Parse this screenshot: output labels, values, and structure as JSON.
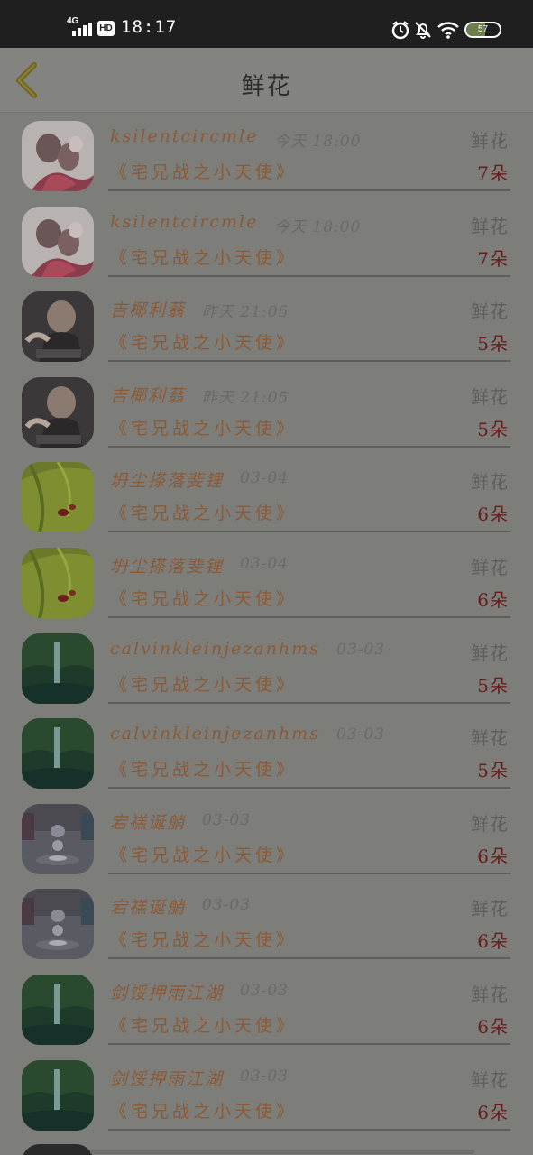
{
  "status_bar": {
    "network": "4G",
    "hd": "HD",
    "time": "18:17",
    "battery_level": "57",
    "icons": [
      "signal-icon",
      "alarm-icon",
      "bell-off-icon",
      "wifi-icon",
      "battery-icon"
    ]
  },
  "header": {
    "title": "鲜花",
    "back_icon": "chevron-left-icon",
    "back_color": "#7a6a2a"
  },
  "colors": {
    "username": "#8b5a36",
    "count": "#6b1d1d",
    "muted": "#5f5f5c"
  },
  "records": [
    {
      "user": "ksilentcircmle",
      "time": "今天 18:00",
      "gift": "鲜花",
      "book": "《宅兄战之小天使》",
      "count": "7朵",
      "avatar": "avatar-anime-couple"
    },
    {
      "user": "ksilentcircmle",
      "time": "今天 18:00",
      "gift": "鲜花",
      "book": "《宅兄战之小天使》",
      "count": "7朵",
      "avatar": "avatar-anime-couple"
    },
    {
      "user": "吉椰利蓊",
      "time": "昨天 21:05",
      "gift": "鲜花",
      "book": "《宅兄战之小天使》",
      "count": "5朵",
      "avatar": "avatar-photo-man"
    },
    {
      "user": "吉椰利蓊",
      "time": "昨天 21:05",
      "gift": "鲜花",
      "book": "《宅兄战之小天使》",
      "count": "5朵",
      "avatar": "avatar-photo-man"
    },
    {
      "user": "坍尘搽落斐锂",
      "time": "03-04",
      "gift": "鲜花",
      "book": "《宅兄战之小天使》",
      "count": "6朵",
      "avatar": "avatar-green-leaves"
    },
    {
      "user": "坍尘搽落斐锂",
      "time": "03-04",
      "gift": "鲜花",
      "book": "《宅兄战之小天使》",
      "count": "6朵",
      "avatar": "avatar-green-leaves"
    },
    {
      "user": "calvinkleinjezanhms",
      "time": "03-03",
      "gift": "鲜花",
      "book": "《宅兄战之小天使》",
      "count": "5朵",
      "avatar": "avatar-waterfall"
    },
    {
      "user": "calvinkleinjezanhms",
      "time": "03-03",
      "gift": "鲜花",
      "book": "《宅兄战之小天使》",
      "count": "5朵",
      "avatar": "avatar-waterfall"
    },
    {
      "user": "宕禚诞艄",
      "time": "03-03",
      "gift": "鲜花",
      "book": "《宅兄战之小天使》",
      "count": "6朵",
      "avatar": "avatar-water-drop"
    },
    {
      "user": "宕禚诞艄",
      "time": "03-03",
      "gift": "鲜花",
      "book": "《宅兄战之小天使》",
      "count": "6朵",
      "avatar": "avatar-water-drop"
    },
    {
      "user": "剑馁押雨江湖",
      "time": "03-03",
      "gift": "鲜花",
      "book": "《宅兄战之小天使》",
      "count": "6朵",
      "avatar": "avatar-waterfall"
    },
    {
      "user": "剑馁押雨江湖",
      "time": "03-03",
      "gift": "鲜花",
      "book": "《宅兄战之小天使》",
      "count": "6朵",
      "avatar": "avatar-waterfall"
    }
  ]
}
